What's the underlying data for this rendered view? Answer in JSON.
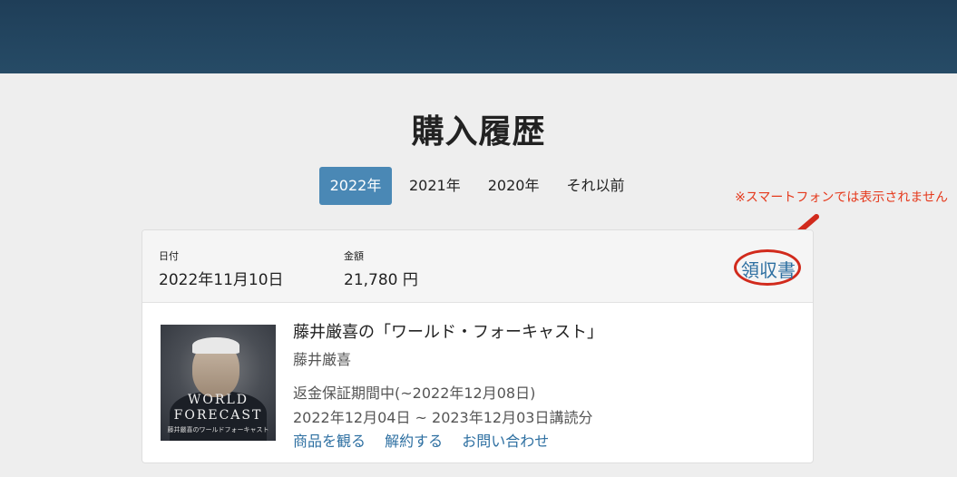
{
  "page": {
    "title": "購入履歴"
  },
  "year_tabs": [
    {
      "label": "2022年",
      "active": true
    },
    {
      "label": "2021年",
      "active": false
    },
    {
      "label": "2020年",
      "active": false
    },
    {
      "label": "それ以前",
      "active": false
    }
  ],
  "note": "※スマートフォンでは表示されません",
  "order": {
    "date_label": "日付",
    "date_value": "2022年11月10日",
    "amount_label": "金額",
    "amount_value": "21,780 円",
    "receipt_link": "領収書",
    "product": {
      "image_text_1": "WORLD",
      "image_text_2": "FORECAST",
      "image_text_3": "藤井厳喜のワールドフォーキャスト",
      "title": "藤井厳喜の「ワールド・フォーキャスト」",
      "author": "藤井厳喜",
      "refund_status": "返金保証期間中(~2022年12月08日)",
      "subscription_period": "2022年12月04日 ~ 2023年12月03日講読分",
      "links": [
        "商品を観る",
        "解約する",
        "お問い合わせ"
      ]
    }
  },
  "colors": {
    "header_bg": "#264b66",
    "active_tab_bg": "#4a88b5",
    "link": "#2d6fa1",
    "annotation_red": "#d12a1c"
  }
}
